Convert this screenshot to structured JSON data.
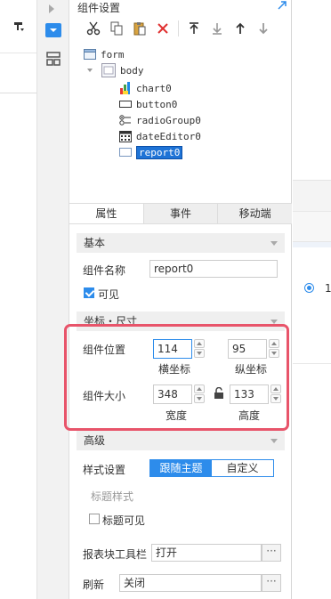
{
  "panel": {
    "title": "组件设置"
  },
  "tree": {
    "items": [
      {
        "label": "form",
        "icon": "form-icon"
      },
      {
        "label": "body",
        "icon": "body-icon"
      },
      {
        "label": "chart0",
        "icon": "chart-icon"
      },
      {
        "label": "button0",
        "icon": "button-icon"
      },
      {
        "label": "radioGroup0",
        "icon": "radio-group-icon"
      },
      {
        "label": "dateEditor0",
        "icon": "date-editor-icon"
      },
      {
        "label": "report0",
        "icon": "report-icon",
        "selected": true
      }
    ]
  },
  "tabs": [
    {
      "label": "属性",
      "active": true
    },
    {
      "label": "事件",
      "active": false
    },
    {
      "label": "移动端",
      "active": false
    }
  ],
  "props": {
    "basic_section": "基本",
    "name_label": "组件名称",
    "name_value": "report0",
    "visible_label": "可见",
    "visible_checked": true,
    "coord_section": "坐标・尺寸",
    "position_label": "组件位置",
    "x_value": "114",
    "y_value": "95",
    "x_label": "横坐标",
    "y_label": "纵坐标",
    "size_label": "组件大小",
    "width_value": "348",
    "height_value": "133",
    "width_label": "宽度",
    "height_label": "高度",
    "advanced_section": "高级",
    "style_label": "样式设置",
    "style_follow": "跟随主题",
    "style_custom": "自定义",
    "title_style_label": "标题样式",
    "title_visible_label": "标题可见",
    "title_visible_checked": false,
    "toolbar_label": "报表块工具栏",
    "toolbar_value": "打开",
    "refresh_label": "刷新",
    "refresh_value": "关闭",
    "dots": "···"
  },
  "right": {
    "radio_text": "1"
  },
  "colors": {
    "accent": "#2d8ceb",
    "highlight": "#e8546a",
    "selected": "#1e73d6"
  }
}
